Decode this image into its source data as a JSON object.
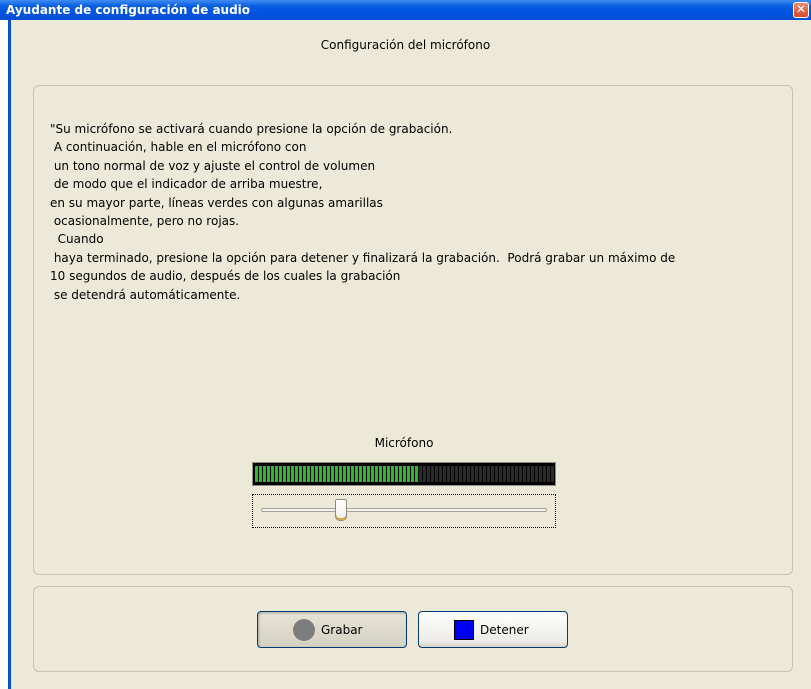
{
  "window": {
    "title": "Ayudante de configuración de audio",
    "close_glyph": "✕"
  },
  "section": {
    "heading": "Configuración del micrófono"
  },
  "instructions": {
    "lines": [
      "\"Su micrófono se activará cuando presione la opción de grabación.",
      " A continuación, hable en el micrófono con",
      " un tono normal de voz y ajuste el control de volumen",
      " de modo que el indicador de arriba muestre,",
      "en su mayor parte, líneas verdes con algunas amarillas",
      " ocasionalmente, pero no rojas.",
      "  Cuando",
      " haya terminado, presione la opción para detener y finalizará la grabación.  Podrá grabar un máximo de",
      "10 segundos de audio, después de los cuales la grabación",
      " se detendrá automáticamente."
    ]
  },
  "microphone": {
    "label": "Micrófono",
    "level_fraction": 0.55,
    "total_bars": 75,
    "active_color": "#2fb82f",
    "inactive_color": "#2b2b2b",
    "volume_fraction": 0.27
  },
  "buttons": {
    "record": {
      "label": "Grabar",
      "icon": "record-circle-icon",
      "color": "#7d7d7d"
    },
    "stop": {
      "label": "Detener",
      "icon": "stop-square-icon",
      "color": "#0000f0"
    }
  },
  "colors": {
    "titlebar": "#0054e3",
    "background": "#ece9d8"
  }
}
